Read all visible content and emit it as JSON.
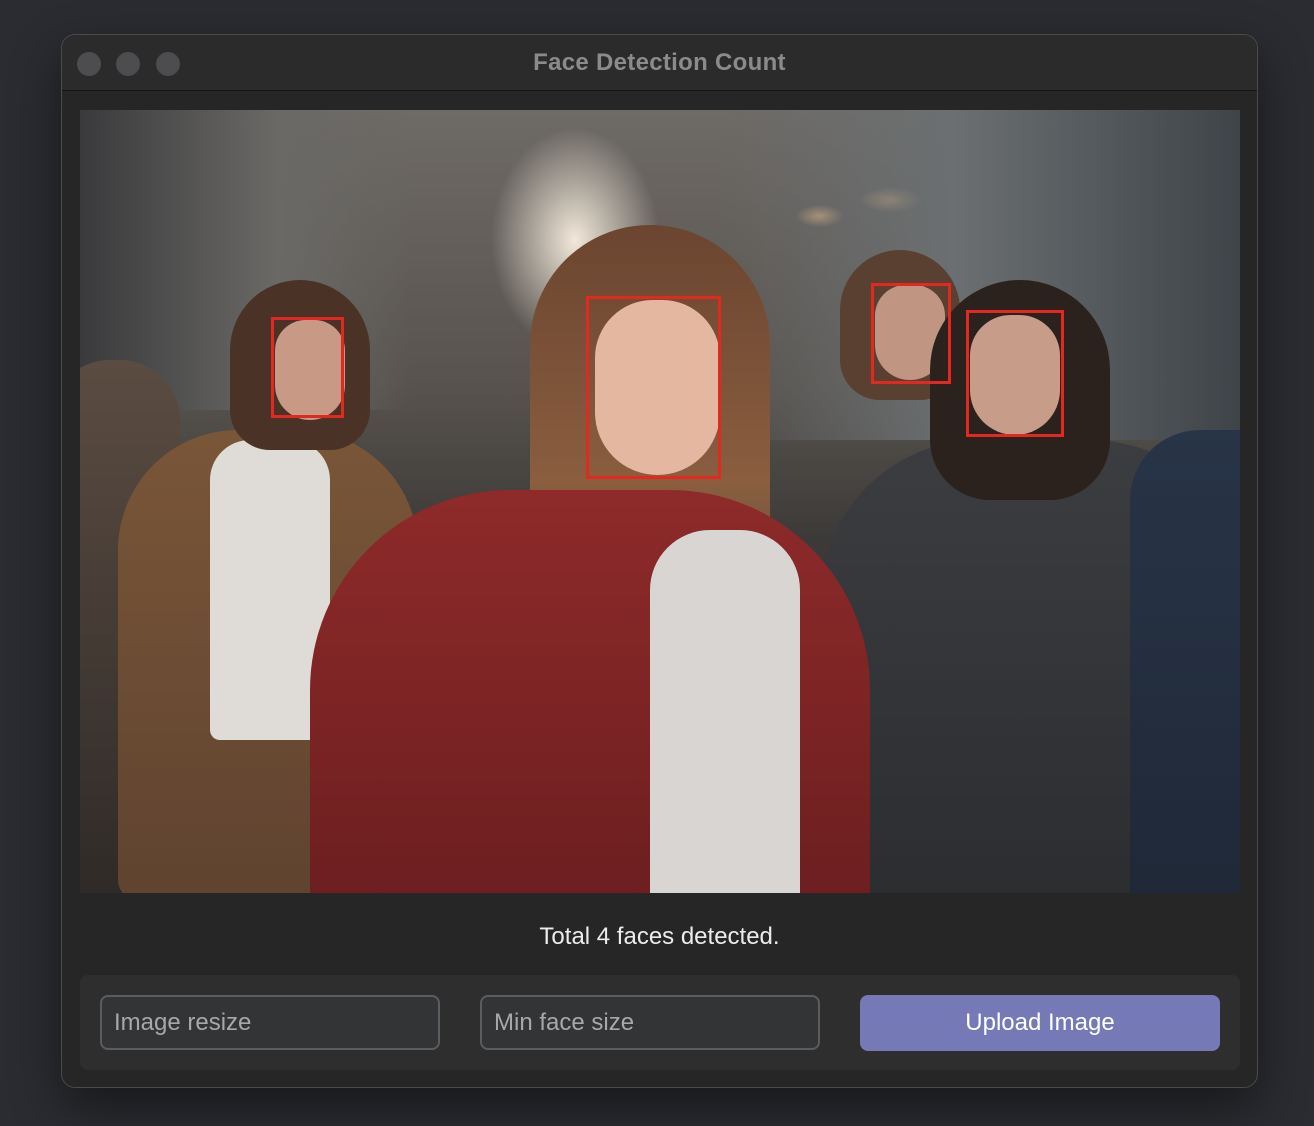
{
  "window": {
    "title": "Face Detection Count"
  },
  "image_view": {
    "detected_face_count": 4
  },
  "status": {
    "text": "Total 4 faces detected."
  },
  "controls": {
    "image_resize": {
      "placeholder": "Image resize",
      "value": ""
    },
    "min_face_size": {
      "placeholder": "Min face size",
      "value": ""
    },
    "upload_button_label": "Upload Image"
  },
  "colors": {
    "accent_button": "#7579b6",
    "face_box": "#e3291f",
    "window_bg": "#262626"
  }
}
